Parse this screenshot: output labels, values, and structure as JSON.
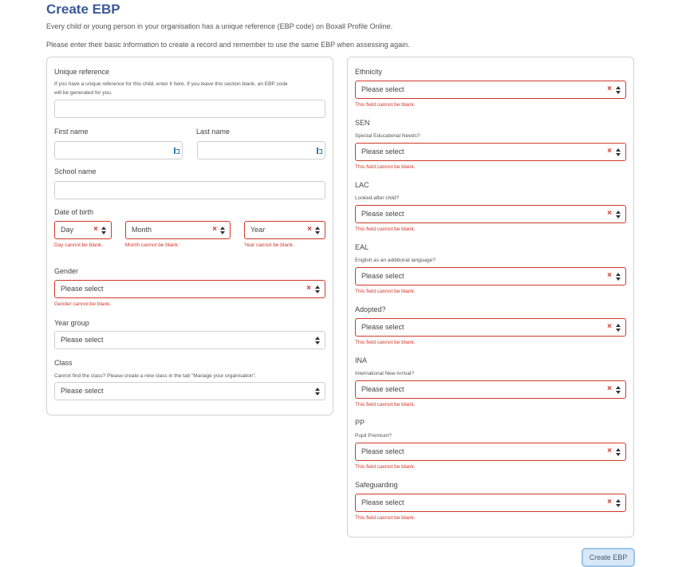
{
  "page": {
    "title": "Create EBP",
    "intro_1": "Every child or young person in your organisation has a unique reference (EBP code) on Boxall Profile Online.",
    "intro_2": "Please enter their basic information to create a record and remember to use the same EBP when assessing again."
  },
  "left": {
    "unique_ref": {
      "label": "Unique reference",
      "help_1": "If you have a unique reference for this child, enter it here. If you leave this section blank, an EBP code",
      "help_2": "will be generated for you.",
      "value": ""
    },
    "first_name": {
      "label": "First name",
      "value": ""
    },
    "last_name": {
      "label": "Last name",
      "value": ""
    },
    "school_name": {
      "label": "School name",
      "value": ""
    },
    "dob": {
      "label": "Date of birth",
      "day": {
        "value": "Day",
        "error": "Day cannot be blank."
      },
      "month": {
        "value": "Month",
        "error": "Month cannot be blank."
      },
      "year": {
        "value": "Year",
        "error": "Year cannot be blank."
      }
    },
    "gender": {
      "label": "Gender",
      "value": "Please select",
      "error": "Gender cannot be blank."
    },
    "year_group": {
      "label": "Year group",
      "value": "Please select"
    },
    "class": {
      "label": "Class",
      "help": "Cannot find the class? Please create a new class in the tab \"Manage your organisation\".",
      "value": "Please select"
    }
  },
  "right": {
    "ethnicity": {
      "label": "Ethnicity",
      "value": "Please select",
      "error": "This field cannot be blank."
    },
    "sen": {
      "label": "SEN",
      "help": "Special Educational Needs?",
      "value": "Please select",
      "error": "This field cannot be blank."
    },
    "lac": {
      "label": "LAC",
      "help": "Looked-after child?",
      "value": "Please select",
      "error": "This field cannot be blank."
    },
    "eal": {
      "label": "EAL",
      "help": "English as an additional language?",
      "value": "Please select",
      "error": "This field cannot be blank."
    },
    "adopted": {
      "label": "Adopted?",
      "value": "Please select",
      "error": "This field cannot be blank."
    },
    "ina": {
      "label": "INA",
      "help": "International New Arrival?",
      "value": "Please select",
      "error": "This field cannot be blank."
    },
    "pp": {
      "label": "PP",
      "help": "Pupil Premium?",
      "value": "Please select",
      "error": "This field cannot be blank."
    },
    "safeguarding": {
      "label": "Safeguarding",
      "value": "Please select",
      "error": "This field cannot be blank."
    }
  },
  "actions": {
    "submit_label": "Create EBP"
  },
  "icons": {
    "clear": "×",
    "clear_name": "clear-icon",
    "arrows_name": "select-arrows-icon",
    "key_name": "password-manager-icon"
  },
  "colors": {
    "title": "#3b5998",
    "error": "#d0382b",
    "button_bg": "#d9e8f6",
    "button_border": "#9cc4ea"
  }
}
